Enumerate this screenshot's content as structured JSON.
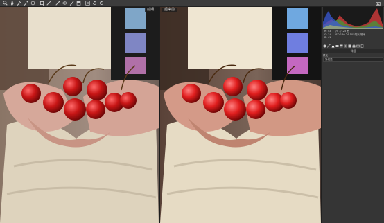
{
  "toolbar": {
    "tools": [
      "zoom-icon",
      "hand-icon",
      "white-balance-icon",
      "color-sampler-icon",
      "target-adjust-icon",
      "crop-icon",
      "straighten-icon",
      "spot-removal-icon",
      "red-eye-icon",
      "adjustment-brush-icon",
      "graduated-filter-icon",
      "preferences-icon",
      "rotate-left-icon",
      "rotate-right-icon"
    ]
  },
  "panes": {
    "before_label": "前期",
    "after_label": "后来前"
  },
  "panel": {
    "readout": {
      "r_label": "R:",
      "r_value": "43",
      "g_label": "G:",
      "g_value": "34",
      "b_label": "B:",
      "b_value": "41",
      "line1": "f/5   1/125 秒",
      "line2": "ISO 160   24-105毫米 毫米"
    },
    "title": "详细",
    "sub_label": "锐化",
    "field_value": "补给量"
  },
  "colors": {
    "accent": "#e03030",
    "panel_bg": "#353535",
    "toolbar_bg": "#3c3c3c"
  }
}
